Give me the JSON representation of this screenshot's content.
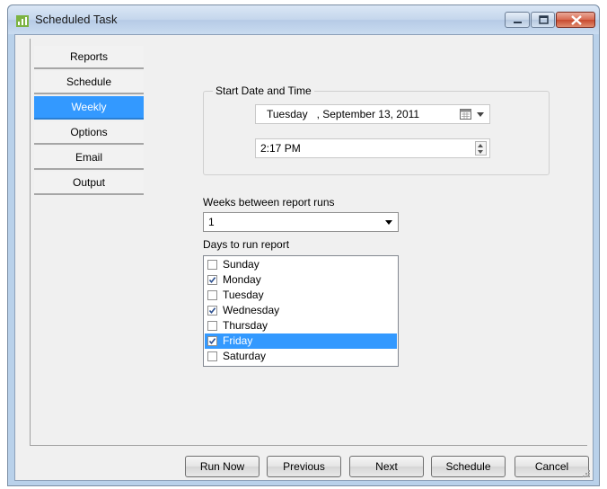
{
  "window": {
    "title": "Scheduled Task",
    "icon": "chart-app-icon",
    "controls": [
      "minimize-icon",
      "maximize-icon",
      "close-icon"
    ]
  },
  "tabs": [
    {
      "label": "Reports",
      "active": false
    },
    {
      "label": "Schedule",
      "active": false
    },
    {
      "label": "Weekly",
      "active": true
    },
    {
      "label": "Options",
      "active": false
    },
    {
      "label": "Email",
      "active": false
    },
    {
      "label": "Output",
      "active": false
    }
  ],
  "start": {
    "group_label": "Start Date and Time",
    "date_value": "Tuesday   , September 13, 2011",
    "time_value": "2:17 PM"
  },
  "weeks": {
    "label": "Weeks between report runs",
    "value": "1"
  },
  "days": {
    "label": "Days to run report",
    "items": [
      {
        "label": "Sunday",
        "checked": false,
        "selected": false
      },
      {
        "label": "Monday",
        "checked": true,
        "selected": false
      },
      {
        "label": "Tuesday",
        "checked": false,
        "selected": false
      },
      {
        "label": "Wednesday",
        "checked": true,
        "selected": false
      },
      {
        "label": "Thursday",
        "checked": false,
        "selected": false
      },
      {
        "label": "Friday",
        "checked": true,
        "selected": true
      },
      {
        "label": "Saturday",
        "checked": false,
        "selected": false
      }
    ]
  },
  "buttons": {
    "run_now": "Run Now",
    "previous": "Previous",
    "next": "Next",
    "schedule": "Schedule",
    "cancel": "Cancel"
  },
  "colors": {
    "accent": "#3399ff",
    "frame": "#b9d1ea",
    "close": "#c74a30"
  }
}
